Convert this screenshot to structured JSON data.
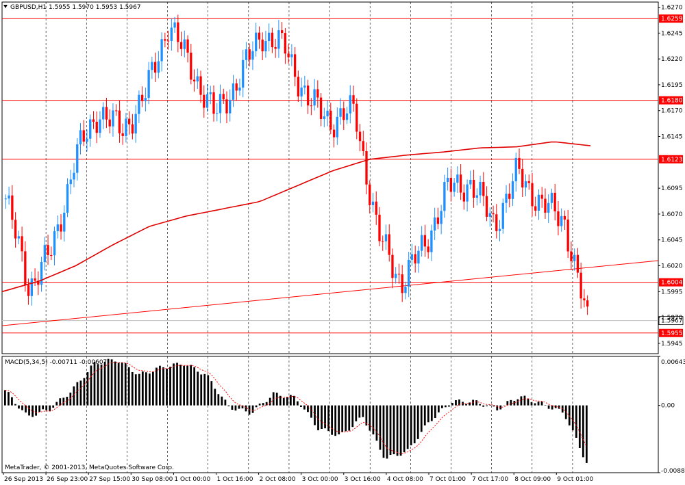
{
  "chart_data": [
    {
      "type": "candlestick",
      "title": "GBPUSD,H1  1.5955 1.5970 1.5953 1.5967",
      "symbol": "GBPUSD",
      "timeframe": "H1",
      "ohlc_last": {
        "open": 1.5955,
        "high": 1.597,
        "low": 1.5953,
        "close": 1.5967
      },
      "ylim": [
        1.5935,
        1.6275
      ],
      "y_ticks": [
        "1.6270",
        "1.6245",
        "1.6220",
        "1.6195",
        "1.6170",
        "1.6145",
        "1.6095",
        "1.6070",
        "1.6045",
        "1.6020",
        "1.5995",
        "1.5970",
        "1.5945"
      ],
      "x_ticks": [
        "26 Sep 2013",
        "26 Sep 23:00",
        "27 Sep 15:00",
        "30 Sep 08:00",
        "1 Oct 00:00",
        "1 Oct 16:00",
        "2 Oct 08:00",
        "3 Oct 00:00",
        "3 Oct 16:00",
        "4 Oct 08:00",
        "7 Oct 01:00",
        "7 Oct 17:00",
        "8 Oct 09:00",
        "9 Oct 01:00"
      ],
      "horizontal_levels": [
        {
          "label": "1.6259",
          "value": 1.6259
        },
        {
          "label": "1.6180",
          "value": 1.618
        },
        {
          "label": "1.6123",
          "value": 1.6123
        },
        {
          "label": "1.6004",
          "value": 1.6004
        },
        {
          "label": "1.5955",
          "value": 1.5955
        }
      ],
      "current_price": {
        "label": "1.5967",
        "value": 1.5967
      },
      "trendline": {
        "start_value": 1.5962,
        "end_value": 1.6025
      },
      "moving_average_path": [
        1.5995,
        1.6005,
        1.602,
        1.604,
        1.6058,
        1.6068,
        1.6075,
        1.6082,
        1.6097,
        1.6112,
        1.6123,
        1.6127,
        1.613,
        1.6134,
        1.6135,
        1.614,
        1.6136
      ],
      "close_path": [
        1.6085,
        1.6,
        1.6035,
        1.6125,
        1.617,
        1.615,
        1.6185,
        1.6255,
        1.621,
        1.6165,
        1.62,
        1.6245,
        1.623,
        1.618,
        1.616,
        1.617,
        1.605,
        1.6004,
        1.604,
        1.6095,
        1.61,
        1.606,
        1.611,
        1.608,
        1.6065,
        1.5965
      ],
      "grid": true,
      "colors": {
        "bull": "#1e90ff",
        "bear": "#ff0000",
        "levels": "#ff0000",
        "ma": "#e00000",
        "grid": "#000000"
      }
    },
    {
      "type": "bar",
      "title": "MACD(5,34,5) -0.00711 -0.00607",
      "indicator": "MACD(5,34,5)",
      "values_last": [
        -0.00711,
        -0.00607
      ],
      "ylim": [
        -0.00883,
        0.00643
      ],
      "y_ticks": [
        "0.00643",
        "0.00",
        "-0.00883"
      ],
      "histogram_path": [
        0.002,
        -0.0015,
        -0.0005,
        0.002,
        0.0055,
        0.006,
        0.004,
        0.005,
        0.0055,
        0.004,
        -0.0002,
        -0.001,
        0.0015,
        0.001,
        -0.003,
        -0.004,
        -0.0015,
        -0.007,
        -0.006,
        -0.002,
        0.0005,
        0.0005,
        -0.0005,
        0.0012,
        0.0002,
        -0.001,
        -0.0075
      ],
      "signal_color": "#ff0000",
      "bar_color": "#000000"
    }
  ],
  "footer": {
    "copyright": "MetaTrader, © 2001-2013, MetaQuotes Software Corp."
  }
}
